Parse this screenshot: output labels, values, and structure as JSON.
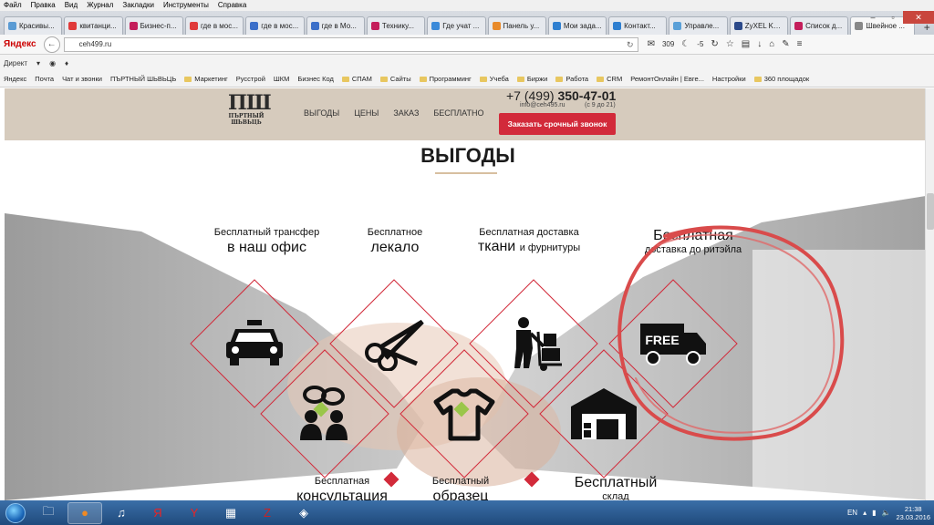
{
  "browser": {
    "menu": [
      "Файл",
      "Правка",
      "Вид",
      "Журнал",
      "Закладки",
      "Инструменты",
      "Справка"
    ],
    "tabs": [
      {
        "label": "Красивы...",
        "color": "#5a9bd4"
      },
      {
        "label": "квитанци...",
        "color": "#e03a3a"
      },
      {
        "label": "Бизнес-п...",
        "color": "#c41e5b"
      },
      {
        "label": "где в мос...",
        "color": "#e03a3a"
      },
      {
        "label": "где в мос...",
        "color": "#3b6fc9"
      },
      {
        "label": "где в Мо...",
        "color": "#3b6fc9"
      },
      {
        "label": "Технику...",
        "color": "#c41e5b"
      },
      {
        "label": "Где учат ...",
        "color": "#3b8ad9"
      },
      {
        "label": "Панель у...",
        "color": "#e88a2a"
      },
      {
        "label": "Мои зада...",
        "color": "#2e7fd0"
      },
      {
        "label": "Контакт...",
        "color": "#2e7fd0"
      },
      {
        "label": "Управле...",
        "color": "#5aa0d8"
      },
      {
        "label": "ZyXEL Ke...",
        "color": "#2c4a8a"
      },
      {
        "label": "Список д...",
        "color": "#c41e5b"
      },
      {
        "label": "Швейное ...",
        "color": "#888888"
      }
    ],
    "brand": "Яндекс",
    "url": "ceh499.ru",
    "mail_count": "309",
    "weather": "-5",
    "yandex_bar": {
      "direct": "Директ"
    },
    "bookmarks": [
      "Яндекс",
      "Почта",
      "Чат и звонки",
      "ПЪРТНЫЙ ШЬВЬЦЬ",
      "Маркетинг",
      "Русстрой",
      "ШКМ",
      "Бизнес Код",
      "СПАМ",
      "Сайты",
      "Программинг",
      "Учеба",
      "Биржи",
      "Работа",
      "CRM",
      "РемонтОнлайн | Евге...",
      "Настройки",
      "360 площадок"
    ]
  },
  "site": {
    "logo_big": "ПШ",
    "logo_small_1": "ПЪРТНЫЙ",
    "logo_small_2": "ШЬВЬЦЬ",
    "nav": [
      "ВЫГОДЫ",
      "ЦЕНЫ",
      "ЗАКАЗ",
      "БЕСПЛАТНО"
    ],
    "phone_prefix": "+7 (499)",
    "phone_number": "350-47-01",
    "email": "info@ceh495.ru",
    "hours": "(с 9 до 21)",
    "call_button": "Заказать срочный звонок"
  },
  "hero": {
    "title": "ВЫГОДЫ",
    "benefits": [
      {
        "small": "Бесплатный трансфер",
        "large": "в наш офис"
      },
      {
        "small": "Бесплатное",
        "large": "лекало"
      },
      {
        "small": "Бесплатная доставка",
        "large": "ткани",
        "tail": "и фурнитуры"
      },
      {
        "large": "Бесплатная",
        "small": "доставка до ритэйла"
      }
    ],
    "bottom_labels": [
      {
        "small": "Бесплатная",
        "large": "консультация"
      },
      {
        "small": "Бесплатный",
        "large": "образец"
      },
      {
        "large": "Бесплатный",
        "small": "склад"
      }
    ],
    "truck_text": "FREE",
    "icons": [
      "taxi-icon",
      "scissors-icon",
      "delivery-man-icon",
      "free-truck-icon",
      "consultation-icon",
      "tshirt-icon",
      "warehouse-icon"
    ],
    "accent": "#d22a3a",
    "green": "#9ac64a"
  },
  "taskbar": {
    "lang": "EN",
    "time": "21:38",
    "date": "23.03.2016"
  }
}
